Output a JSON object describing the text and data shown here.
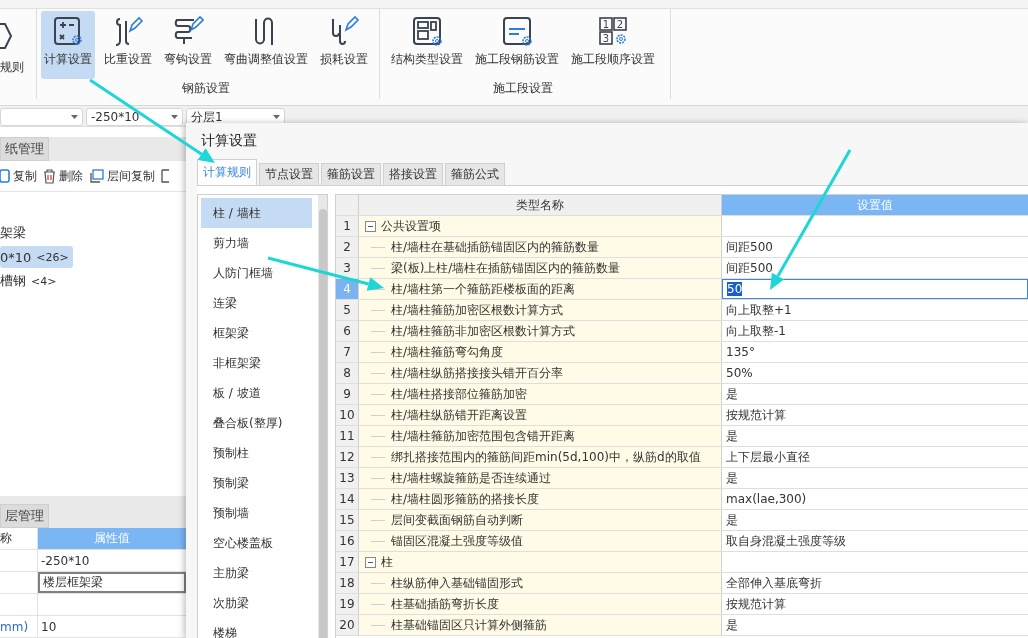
{
  "ribbon": {
    "partial_button": {
      "label": "规则"
    },
    "groups": [
      {
        "label": "钢筋设置",
        "buttons": [
          {
            "label": "计算设置",
            "selected": true
          },
          {
            "label": "比重设置",
            "selected": false
          },
          {
            "label": "弯钩设置",
            "selected": false
          },
          {
            "label": "弯曲调整值设置",
            "selected": false
          },
          {
            "label": "损耗设置",
            "selected": false
          }
        ]
      },
      {
        "label": "施工段设置",
        "buttons": [
          {
            "label": "结构类型设置",
            "selected": false
          },
          {
            "label": "施工段钢筋设置",
            "selected": false
          },
          {
            "label": "施工段顺序设置",
            "selected": false,
            "icon_digits": [
              "1",
              "2",
              "3"
            ]
          }
        ]
      }
    ]
  },
  "combos": [
    {
      "value": "-250*10"
    },
    {
      "value": "分层1"
    }
  ],
  "left_panel": {
    "tab": "纸管理",
    "toolbar": [
      {
        "label": "复制"
      },
      {
        "label": "删除"
      },
      {
        "label": "层间复制"
      }
    ],
    "tree": [
      {
        "label": "架梁",
        "selected": false
      },
      {
        "label": "0*10",
        "count": "<26>",
        "selected": true
      },
      {
        "label": "槽钢",
        "count": "<4>",
        "selected": false
      }
    ]
  },
  "properties": {
    "tab": "层管理",
    "columns": [
      "称",
      "属性值"
    ],
    "rows": [
      {
        "value": "-250*10",
        "editing": false
      },
      {
        "value": "楼层框架梁",
        "editing": true
      },
      {
        "editing": false
      },
      {
        "name": "mm)",
        "value": "10",
        "editing": false
      }
    ]
  },
  "dialog": {
    "title": "计算设置",
    "tabs": [
      {
        "label": "计算规则",
        "selected": true
      },
      {
        "label": "节点设置",
        "selected": false
      },
      {
        "label": "箍筋设置",
        "selected": false
      },
      {
        "label": "搭接设置",
        "selected": false
      },
      {
        "label": "箍筋公式",
        "selected": false
      }
    ],
    "categories": [
      {
        "label": "柱 / 墙柱",
        "selected": true
      },
      {
        "label": "剪力墙",
        "selected": false
      },
      {
        "label": "人防门框墙",
        "selected": false
      },
      {
        "label": "连梁",
        "selected": false
      },
      {
        "label": "框架梁",
        "selected": false
      },
      {
        "label": "非框架梁",
        "selected": false
      },
      {
        "label": "板 / 坡道",
        "selected": false
      },
      {
        "label": "叠合板(整厚)",
        "selected": false
      },
      {
        "label": "预制柱",
        "selected": false
      },
      {
        "label": "预制梁",
        "selected": false
      },
      {
        "label": "预制墙",
        "selected": false
      },
      {
        "label": "空心楼盖板",
        "selected": false
      },
      {
        "label": "主肋梁",
        "selected": false
      },
      {
        "label": "次肋梁",
        "selected": false
      },
      {
        "label": "楼梯",
        "selected": false
      }
    ],
    "grid": {
      "columns": [
        "类型名称",
        "设置值"
      ],
      "rows": [
        {
          "number": "1",
          "kind": "group",
          "label": "公共设置项",
          "expanded": true,
          "selected": false
        },
        {
          "number": "2",
          "kind": "item",
          "label": "柱/墙柱在基础插筋锚固区内的箍筋数量",
          "value": "间距500",
          "selected": false
        },
        {
          "number": "3",
          "kind": "item",
          "label": "梁(板)上柱/墙柱在插筋锚固区内的箍筋数量",
          "value": "间距500",
          "selected": false
        },
        {
          "number": "4",
          "kind": "item",
          "label": "柱/墙柱第一个箍筋距楼板面的距离",
          "value": "50",
          "selected": true
        },
        {
          "number": "5",
          "kind": "item",
          "label": "柱/墙柱箍筋加密区根数计算方式",
          "value": "向上取整+1",
          "selected": false
        },
        {
          "number": "6",
          "kind": "item",
          "label": "柱/墙柱箍筋非加密区根数计算方式",
          "value": "向上取整-1",
          "selected": false
        },
        {
          "number": "7",
          "kind": "item",
          "label": "柱/墙柱箍筋弯勾角度",
          "value": "135°",
          "selected": false
        },
        {
          "number": "8",
          "kind": "item",
          "label": "柱/墙柱纵筋搭接接头错开百分率",
          "value": "50%",
          "selected": false
        },
        {
          "number": "9",
          "kind": "item",
          "label": "柱/墙柱搭接部位箍筋加密",
          "value": "是",
          "selected": false
        },
        {
          "number": "10",
          "kind": "item",
          "label": "柱/墙柱纵筋错开距离设置",
          "value": "按规范计算",
          "selected": false
        },
        {
          "number": "11",
          "kind": "item",
          "label": "柱/墙柱箍筋加密范围包含错开距离",
          "value": "是",
          "selected": false
        },
        {
          "number": "12",
          "kind": "item",
          "label": "绑扎搭接范围内的箍筋间距min(5d,100)中，纵筋d的取值",
          "value": "上下层最小直径",
          "selected": false
        },
        {
          "number": "13",
          "kind": "item",
          "label": "柱/墙柱螺旋箍筋是否连续通过",
          "value": "是",
          "selected": false
        },
        {
          "number": "14",
          "kind": "item",
          "label": "柱/墙柱圆形箍筋的搭接长度",
          "value": "max(lae,300)",
          "selected": false
        },
        {
          "number": "15",
          "kind": "item",
          "label": "层间变截面钢筋自动判断",
          "value": "是",
          "selected": false
        },
        {
          "number": "16",
          "kind": "item",
          "label": "锚固区混凝土强度等级值",
          "value": "取自身混凝土强度等级",
          "selected": false
        },
        {
          "number": "17",
          "kind": "group",
          "label": "柱",
          "expanded": true,
          "selected": false
        },
        {
          "number": "18",
          "kind": "item",
          "label": "柱纵筋伸入基础锚固形式",
          "value": "全部伸入基底弯折",
          "selected": false
        },
        {
          "number": "19",
          "kind": "item",
          "label": "柱基础插筋弯折长度",
          "value": "按规范计算",
          "selected": false
        },
        {
          "number": "20",
          "kind": "item",
          "label": "柱基础锚固区只计算外侧箍筋",
          "value": "是",
          "selected": false
        }
      ]
    }
  }
}
